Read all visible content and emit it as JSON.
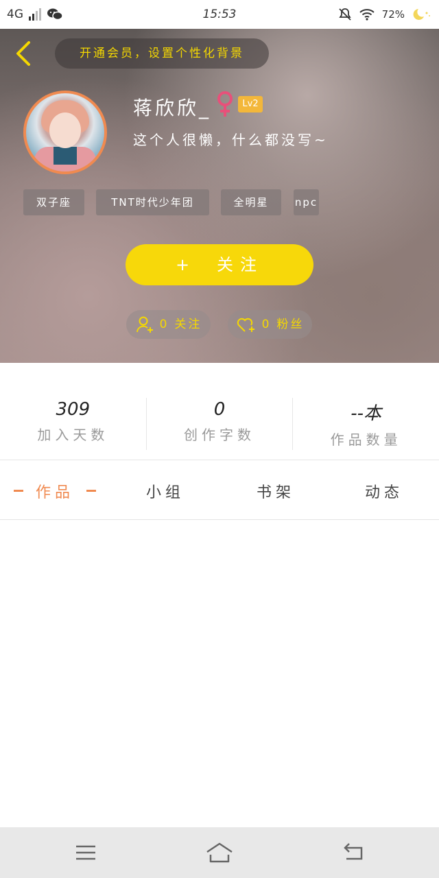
{
  "status_bar": {
    "network": "4G",
    "time": "15:53",
    "battery": "72%"
  },
  "header": {
    "background_tip": "开通会员，设置个性化背景",
    "username": "蒋欣欣_",
    "level": "Lv2",
    "bio": "这个人很懒，什么都没写~",
    "tags": [
      "双子座",
      "TNT时代少年团",
      "全明星",
      "npc"
    ],
    "follow_label": "关注",
    "follow_plus": "+",
    "following_count": "0",
    "following_label": "关注",
    "fans_count": "0",
    "fans_label": "粉丝"
  },
  "stats": [
    {
      "value": "309",
      "label": "加入天数"
    },
    {
      "value": "0",
      "label": "创作字数"
    },
    {
      "value": "--本",
      "label": "作品数量"
    }
  ],
  "tabs": [
    "作品",
    "小组",
    "书架",
    "动态"
  ],
  "colors": {
    "accent_yellow": "#f7d80a",
    "accent_orange": "#f08a50",
    "gender_pink": "#e8507a",
    "level_badge": "#f3b73a"
  },
  "icons": {
    "back": "chevron-left-icon",
    "gender": "female-icon",
    "following": "user-add-icon",
    "fans": "heart-add-icon",
    "nav_menu": "menu-icon",
    "nav_home": "home-icon",
    "nav_back": "back-icon"
  }
}
